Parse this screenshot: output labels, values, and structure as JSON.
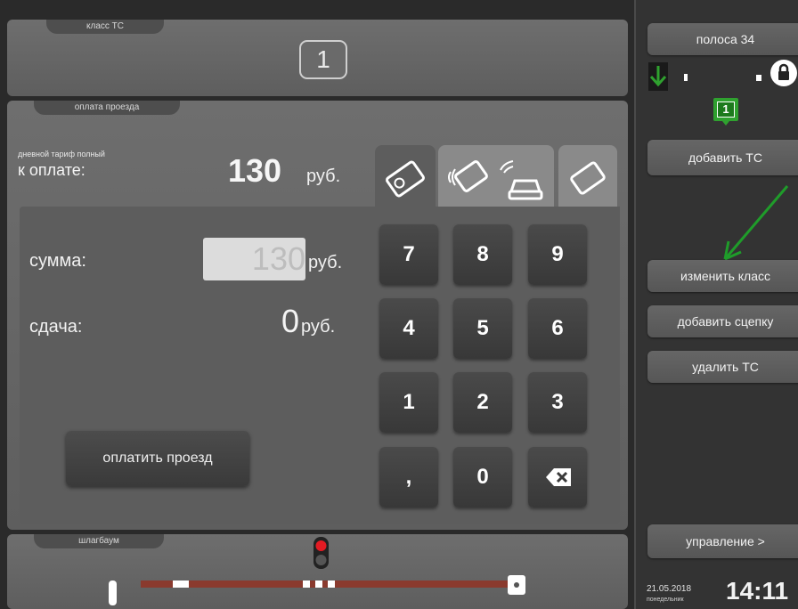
{
  "vehicle_class": {
    "tab_label": "класс ТС",
    "value": "1"
  },
  "payment": {
    "tab_label": "оплата проезда",
    "tariff_label": "дневной тариф полный",
    "to_pay_label": "к оплате:",
    "to_pay_value": "130",
    "currency": "руб.",
    "sum_label": "сумма:",
    "sum_value": "130",
    "change_label": "сдача:",
    "change_value": "0",
    "pay_button": "оплатить проезд",
    "method_tabs": [
      "card-icon",
      "contactless-card-icon",
      "car-transponder-icon",
      "card-outline-icon"
    ]
  },
  "keypad": {
    "keys": [
      "7",
      "8",
      "9",
      "4",
      "5",
      "6",
      "1",
      "2",
      "3",
      ",",
      "0",
      "⌫"
    ]
  },
  "barrier": {
    "tab_label": "шлагбаум",
    "status": "red"
  },
  "sidebar": {
    "lane": "полоса 34",
    "current_class": "1",
    "add_vehicle": "добавить ТС",
    "change_class": "изменить класс",
    "add_trailer": "добавить сцепку",
    "delete_vehicle": "удалить ТС",
    "control": "управление >",
    "date": "21.05.2018",
    "weekday": "понедельник",
    "time": "14:11"
  },
  "colors": {
    "accent_green": "#2fa12f",
    "arrow_green": "#1f9c2a",
    "barrier_red": "#e31b23",
    "barrier_arm": "#8a3a2e"
  }
}
